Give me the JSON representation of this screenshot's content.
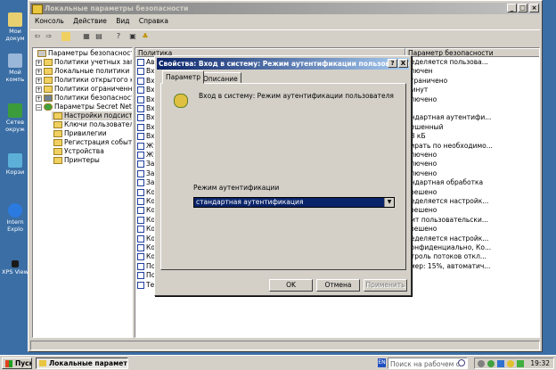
{
  "desktop": {
    "icons": [
      "Мои\nдокум",
      "Мой\nкомпь",
      "Сетев\nокруж",
      "Корзи",
      "Intern\nExplo",
      "XPS View"
    ]
  },
  "window": {
    "title": "Локальные параметры безопасности",
    "menu": [
      "Консоль",
      "Действие",
      "Вид",
      "Справка"
    ]
  },
  "tree": {
    "items": [
      {
        "label": "Параметры безопасности",
        "exp": ""
      },
      {
        "label": "Политики учетных запис",
        "exp": "+"
      },
      {
        "label": "Локальные политики",
        "exp": "+"
      },
      {
        "label": "Политики открытого клю",
        "exp": "+"
      },
      {
        "label": "Политики ограниченного",
        "exp": "+"
      },
      {
        "label": "Политики безопасности",
        "exp": "+"
      },
      {
        "label": "Параметры Secret Net",
        "exp": "−"
      },
      {
        "label": "Настройки подсистем",
        "exp": ""
      },
      {
        "label": "Ключи пользователя",
        "exp": ""
      },
      {
        "label": "Привилегии",
        "exp": ""
      },
      {
        "label": "Регистрация событий",
        "exp": ""
      },
      {
        "label": "Устройства",
        "exp": ""
      },
      {
        "label": "Принтеры",
        "exp": ""
      }
    ]
  },
  "list": {
    "col_policy": "Политика",
    "col_param": "Параметр безопасности",
    "policy_prefixes": [
      "Ав",
      "Вх",
      "Вх",
      "Вх",
      "Вх",
      "Вх",
      "Вх",
      "Вх",
      "Вх",
      "Жу",
      "Жу",
      "За",
      "За",
      "За",
      "Ко",
      "Ко",
      "Ко",
      "Ко",
      "Ко",
      "Ко",
      "Ко",
      "Ко",
      "По",
      "По",
      "Те"
    ],
    "values": [
      "ределяется пользова...",
      "ключен",
      "ограничено",
      "минут",
      "ключено",
      "т",
      "андартная аутентифи...",
      "решенный",
      "48 кБ",
      "тирать по необходимо...",
      "ключено",
      "ключено",
      "ключено",
      "андартная обработка",
      "зрешено",
      "ределяется настройк...",
      "зрешено",
      "дит пользовательски...",
      "зрешено",
      "ределяется настройк...",
      "конфиденциально, Ко...",
      "нтроль потоков откл...",
      "змер: 15%, автоматич..."
    ]
  },
  "dialog": {
    "title": "Свойства: Вход в систему: Режим аутентификации пользователя",
    "help_btn": "?",
    "close_btn": "X",
    "tabs": [
      "Параметр",
      "Описание"
    ],
    "policy_name": "Вход в систему: Режим аутентификации пользователя",
    "mode_label": "Режим аутентификации",
    "mode_value": "стандартная аутентификация",
    "ok": "OK",
    "cancel": "Отмена",
    "apply": "Применить"
  },
  "taskbar": {
    "start": "Пуск",
    "task": "Локальные парамет...",
    "lang": "EN",
    "search_placeholder": "Поиск на рабочем с",
    "clock": "19:32"
  }
}
